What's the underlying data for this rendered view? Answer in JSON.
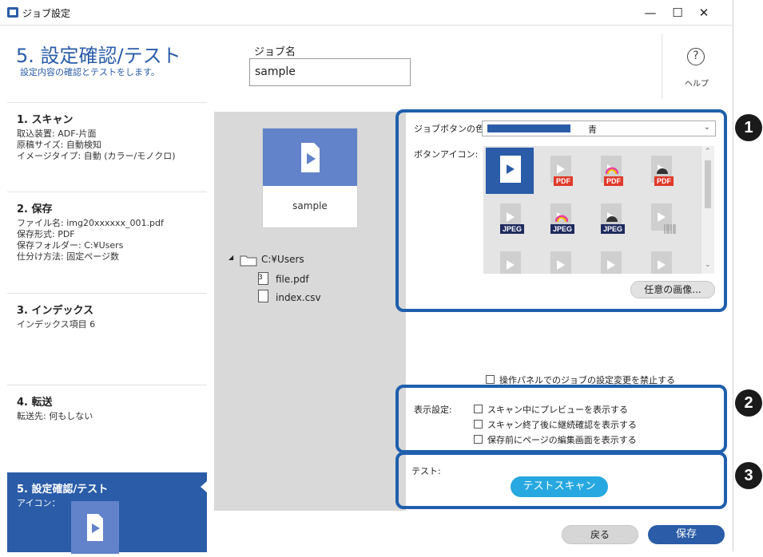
{
  "window": {
    "title": "ジョブ設定",
    "min": "—",
    "max": "☐",
    "close": "✕"
  },
  "header": {
    "title": "5. 設定確認/テスト",
    "subtitle": "設定内容の確認とテストをします。"
  },
  "jobname": {
    "label": "ジョブ名",
    "value": "sample"
  },
  "help": {
    "icon": "?",
    "label": "ヘルプ"
  },
  "sidebar": {
    "items": [
      {
        "title": "1. スキャン",
        "lines": [
          "取込装置: ADF-片面",
          "原稿サイズ: 自動検知",
          "イメージタイプ: 自動 (カラー/モノクロ)"
        ]
      },
      {
        "title": "2. 保存",
        "lines": [
          "ファイル名: img20xxxxxx_001.pdf",
          "保存形式: PDF",
          "保存フォルダー: C:¥Users",
          "仕分け方法: 固定ページ数"
        ]
      },
      {
        "title": "3. インデックス",
        "lines": [
          "インデックス項目 6"
        ]
      },
      {
        "title": "4. 転送",
        "lines": [
          "転送先: 何もしない"
        ]
      },
      {
        "title": "5. 設定確認/テスト",
        "lines": [
          "アイコン："
        ]
      }
    ]
  },
  "preview": {
    "job_button_label": "sample",
    "tree": {
      "expand": "◢",
      "folder": "C:¥Users",
      "file1_num": "3",
      "file1": "file.pdf",
      "file2": "index.csv"
    }
  },
  "settings": {
    "color_label": "ジョブボタンの色:",
    "color_value": "青",
    "color_hex": "#2a5ca8",
    "icon_label": "ボタンアイコン:",
    "custom_image_button": "任意の画像...",
    "lock_checkbox": "操作パネルでのジョブの設定変更を禁止する",
    "display_label": "表示設定:",
    "display_options": [
      "スキャン中にプレビューを表示する",
      "スキャン終了後に継続確認を表示する",
      "保存前にページの編集画面を表示する"
    ],
    "test_label": "テスト:",
    "test_button": "テストスキャン"
  },
  "icons": {
    "badges": [
      "PDF",
      "PDF",
      "PDF",
      "JPEG",
      "JPEG",
      "JPEG"
    ]
  },
  "footer": {
    "back": "戻る",
    "save": "保存"
  },
  "markers": [
    "1",
    "2",
    "3"
  ],
  "colors": {
    "accent": "#2a5ca8",
    "frame": "#1f5fad",
    "test_button": "#27a8e0",
    "pdf": "#e03a2a",
    "jpeg": "#1e2a5e"
  }
}
